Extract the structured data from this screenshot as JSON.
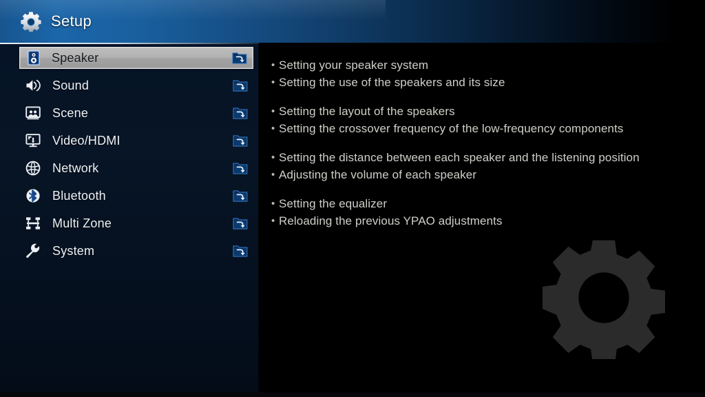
{
  "header": {
    "title": "Setup",
    "icon": "gear-icon",
    "accent_color": "#1b66a9",
    "divider_color": "#e8eef5"
  },
  "sidebar": {
    "background_color": "#061327",
    "selected_index": 0,
    "selected_bg_color": "#b2b2b2",
    "items": [
      {
        "label": "Speaker",
        "icon": "speaker-icon",
        "arrow": "submenu-folder-arrow-icon",
        "selected": true
      },
      {
        "label": "Sound",
        "icon": "sound-icon",
        "arrow": "submenu-folder-arrow-icon",
        "selected": false
      },
      {
        "label": "Scene",
        "icon": "scene-icon",
        "arrow": "submenu-folder-arrow-icon",
        "selected": false
      },
      {
        "label": "Video/HDMI",
        "icon": "monitor-icon",
        "arrow": "submenu-folder-arrow-icon",
        "selected": false
      },
      {
        "label": "Network",
        "icon": "globe-icon",
        "arrow": "submenu-folder-arrow-icon",
        "selected": false
      },
      {
        "label": "Bluetooth",
        "icon": "bluetooth-icon",
        "arrow": "submenu-folder-arrow-icon",
        "selected": false
      },
      {
        "label": "Multi Zone",
        "icon": "multi-zone-icon",
        "arrow": "submenu-folder-arrow-icon",
        "selected": false
      },
      {
        "label": "System",
        "icon": "wrench-icon",
        "arrow": "submenu-folder-arrow-icon",
        "selected": false
      }
    ]
  },
  "description": {
    "text_color": "#cfcfc9",
    "bullet_char": "•",
    "groups": [
      [
        "Setting your speaker system",
        "Setting the use of the speakers and its size"
      ],
      [
        "Setting the layout of the speakers",
        "Setting the crossover frequency of the low-frequency components"
      ],
      [
        "Setting the distance between each speaker and the listening position",
        "Adjusting the volume of each speaker"
      ],
      [
        "Setting the equalizer",
        "Reloading the previous YPAO adjustments"
      ]
    ]
  },
  "watermark": {
    "icon": "gear-icon",
    "color": "#2b2b2b"
  }
}
